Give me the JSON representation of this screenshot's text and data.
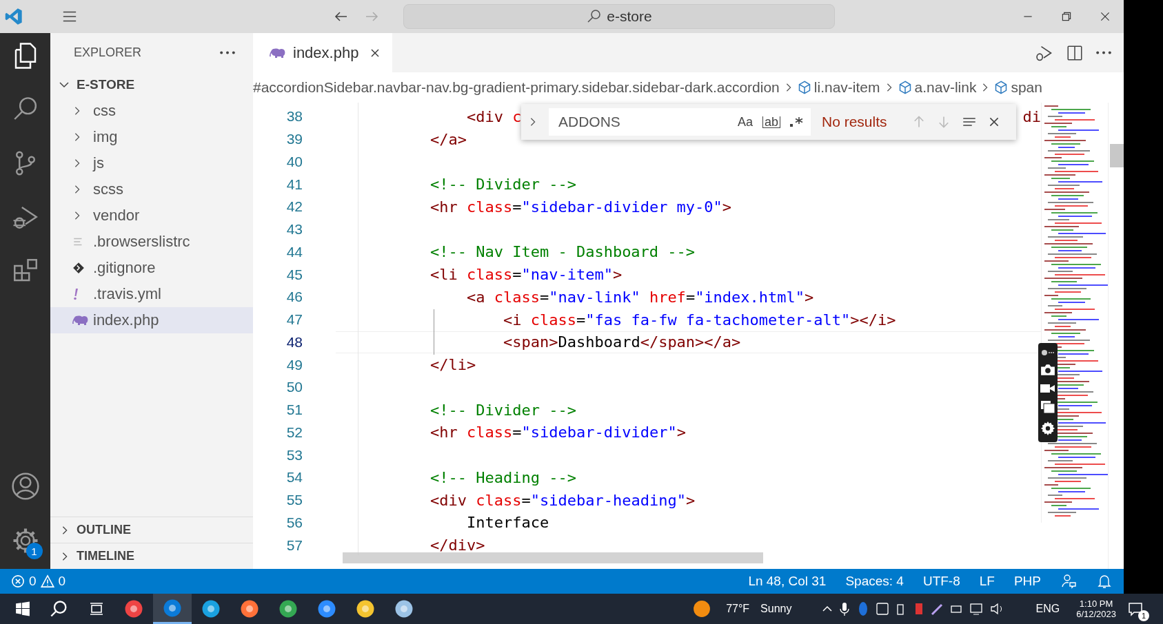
{
  "window": {
    "title": "e-store"
  },
  "activity_bar": {
    "settings_badge": "1"
  },
  "explorer": {
    "title": "EXPLORER",
    "folder": "E-STORE",
    "expanded": true,
    "items": [
      {
        "name": "css",
        "kind": "folder",
        "selected": false
      },
      {
        "name": "img",
        "kind": "folder",
        "selected": false
      },
      {
        "name": "js",
        "kind": "folder",
        "selected": false
      },
      {
        "name": "scss",
        "kind": "folder",
        "selected": false
      },
      {
        "name": "vendor",
        "kind": "folder",
        "selected": false
      },
      {
        "name": ".browserslistrc",
        "kind": "config",
        "selected": false
      },
      {
        "name": ".gitignore",
        "kind": "git",
        "selected": false
      },
      {
        "name": ".travis.yml",
        "kind": "yaml",
        "selected": false
      },
      {
        "name": "index.php",
        "kind": "php",
        "selected": true
      }
    ],
    "sections": [
      {
        "label": "OUTLINE",
        "expanded": false
      },
      {
        "label": "TIMELINE",
        "expanded": false
      }
    ]
  },
  "tabs": [
    {
      "label": "index.php",
      "selected": true
    }
  ],
  "breadcrumb": [
    {
      "label": "#accordionSidebar.navbar-nav.bg-gradient-primary.sidebar.sidebar-dark.accordion",
      "kind": "plain"
    },
    {
      "label": "li.nav-item",
      "kind": "element"
    },
    {
      "label": "a.nav-link",
      "kind": "element"
    },
    {
      "label": "span",
      "kind": "element"
    }
  ],
  "find": {
    "value": "ADDONS",
    "match_case": "Aa",
    "whole_word": "ab",
    "result": "No results"
  },
  "code": {
    "lines": [
      {
        "number": "38",
        "current": false,
        "tokens": [
          {
            "kind": "tag",
            "text": "        <div"
          },
          {
            "kind": "attr",
            "text": " c"
          }
        ],
        "tail": "di"
      },
      {
        "number": "39",
        "current": false,
        "tokens": [
          {
            "kind": "tag",
            "text": "    </a>"
          }
        ]
      },
      {
        "number": "40",
        "current": false
      },
      {
        "number": "41",
        "current": false,
        "tokens": [
          {
            "kind": "comment",
            "text": "    <!-- Divider -->"
          }
        ]
      },
      {
        "number": "42",
        "current": false,
        "tokens": [
          {
            "kind": "tag",
            "text": "    <hr"
          },
          {
            "kind": "attr",
            "text": " class"
          },
          {
            "kind": "text",
            "text": "="
          },
          {
            "kind": "str",
            "text": "\"sidebar-divider my-0\""
          },
          {
            "kind": "tag",
            "text": ">"
          }
        ]
      },
      {
        "number": "43",
        "current": false
      },
      {
        "number": "44",
        "current": false,
        "tokens": [
          {
            "kind": "comment",
            "text": "    <!-- Nav Item - Dashboard -->"
          }
        ]
      },
      {
        "number": "45",
        "current": false,
        "tokens": [
          {
            "kind": "tag",
            "text": "    <li"
          },
          {
            "kind": "attr",
            "text": " class"
          },
          {
            "kind": "text",
            "text": "="
          },
          {
            "kind": "str",
            "text": "\"nav-item\""
          },
          {
            "kind": "tag",
            "text": ">"
          }
        ]
      },
      {
        "number": "46",
        "current": false,
        "tokens": [
          {
            "kind": "tag",
            "text": "        <a"
          },
          {
            "kind": "attr",
            "text": " class"
          },
          {
            "kind": "text",
            "text": "="
          },
          {
            "kind": "str",
            "text": "\"nav-link\""
          },
          {
            "kind": "attr",
            "text": " href"
          },
          {
            "kind": "text",
            "text": "="
          },
          {
            "kind": "str",
            "text": "\"index.html\""
          },
          {
            "kind": "tag",
            "text": ">"
          }
        ]
      },
      {
        "number": "47",
        "current": false,
        "tokens": [
          {
            "kind": "tag",
            "text": "            <i"
          },
          {
            "kind": "attr",
            "text": " class"
          },
          {
            "kind": "text",
            "text": "="
          },
          {
            "kind": "str",
            "text": "\"fas fa-fw fa-tachometer-alt\""
          },
          {
            "kind": "tag",
            "text": "></i>"
          }
        ]
      },
      {
        "number": "48",
        "current": true,
        "tokens": [
          {
            "kind": "tag",
            "text": "            <span>"
          },
          {
            "kind": "text",
            "text": "Dashboard"
          },
          {
            "kind": "tag",
            "text": "</span></a>"
          }
        ]
      },
      {
        "number": "49",
        "current": false,
        "tokens": [
          {
            "kind": "tag",
            "text": "    </li>"
          }
        ]
      },
      {
        "number": "50",
        "current": false
      },
      {
        "number": "51",
        "current": false,
        "tokens": [
          {
            "kind": "comment",
            "text": "    <!-- Divider -->"
          }
        ]
      },
      {
        "number": "52",
        "current": false,
        "tokens": [
          {
            "kind": "tag",
            "text": "    <hr"
          },
          {
            "kind": "attr",
            "text": " class"
          },
          {
            "kind": "text",
            "text": "="
          },
          {
            "kind": "str",
            "text": "\"sidebar-divider\""
          },
          {
            "kind": "tag",
            "text": ">"
          }
        ]
      },
      {
        "number": "53",
        "current": false
      },
      {
        "number": "54",
        "current": false,
        "tokens": [
          {
            "kind": "comment",
            "text": "    <!-- Heading -->"
          }
        ]
      },
      {
        "number": "55",
        "current": false,
        "tokens": [
          {
            "kind": "tag",
            "text": "    <div"
          },
          {
            "kind": "attr",
            "text": " class"
          },
          {
            "kind": "text",
            "text": "="
          },
          {
            "kind": "str",
            "text": "\"sidebar-heading\""
          },
          {
            "kind": "tag",
            "text": ">"
          }
        ]
      },
      {
        "number": "56",
        "current": false,
        "tokens": [
          {
            "kind": "text",
            "text": "        Interface"
          }
        ]
      },
      {
        "number": "57",
        "current": false,
        "tokens": [
          {
            "kind": "tag",
            "text": "    </div>"
          }
        ]
      }
    ]
  },
  "status_bar": {
    "errors": "0",
    "warnings": "0",
    "items": [
      "Ln 48, Col 31",
      "Spaces: 4",
      "UTF-8",
      "LF",
      "PHP"
    ]
  },
  "taskbar": {
    "temperature": "77°F",
    "condition": "Sunny",
    "language": "ENG",
    "time": "1:10 PM",
    "date": "6/12/2023",
    "notifications": "1"
  }
}
